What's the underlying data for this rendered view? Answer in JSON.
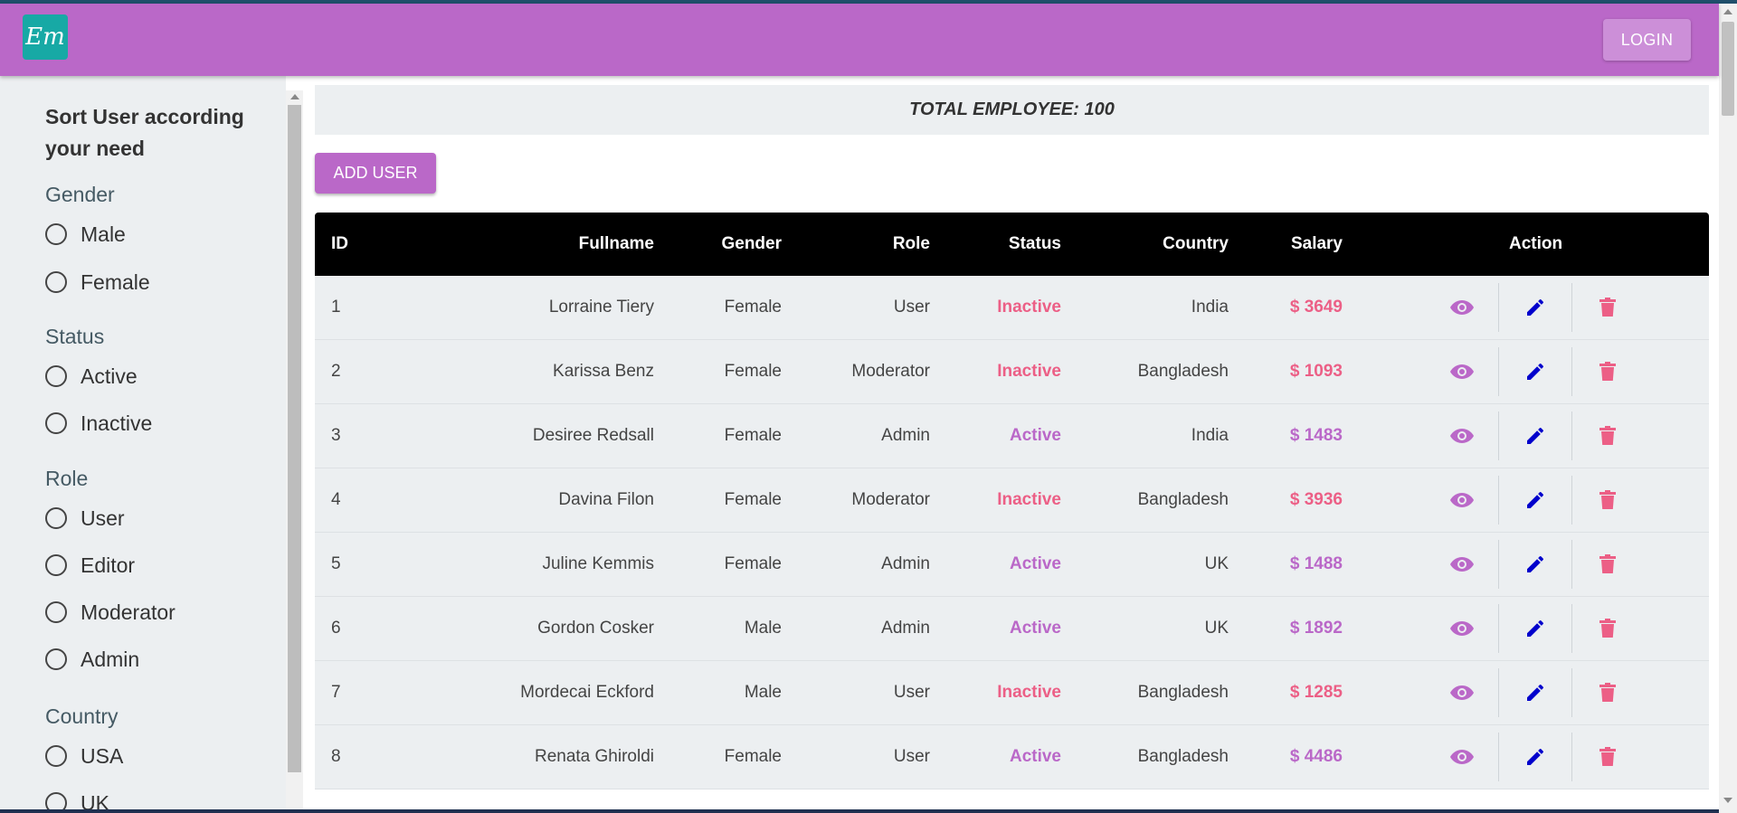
{
  "appbar": {
    "logo_text": "Em",
    "login_label": "LOGIN"
  },
  "sidebar": {
    "title": "Sort User according your need",
    "gender": {
      "heading": "Gender",
      "options": [
        "Male",
        "Female"
      ]
    },
    "status": {
      "heading": "Status",
      "options": [
        "Active",
        "Inactive"
      ]
    },
    "role": {
      "heading": "Role",
      "options": [
        "User",
        "Editor",
        "Moderator",
        "Admin"
      ]
    },
    "country": {
      "heading": "Country",
      "options": [
        "USA",
        "UK"
      ]
    }
  },
  "main": {
    "total_label": "TOTAL EMPLOYEE: 100",
    "add_user_label": "ADD USER"
  },
  "table": {
    "headers": {
      "id": "ID",
      "fullname": "Fullname",
      "gender": "Gender",
      "role": "Role",
      "status": "Status",
      "country": "Country",
      "salary": "Salary",
      "action": "Action"
    },
    "rows": [
      {
        "id": "1",
        "fullname": "Lorraine Tiery",
        "gender": "Female",
        "role": "User",
        "status": "Inactive",
        "country": "India",
        "salary": "$ 3649"
      },
      {
        "id": "2",
        "fullname": "Karissa Benz",
        "gender": "Female",
        "role": "Moderator",
        "status": "Inactive",
        "country": "Bangladesh",
        "salary": "$ 1093"
      },
      {
        "id": "3",
        "fullname": "Desiree Redsall",
        "gender": "Female",
        "role": "Admin",
        "status": "Active",
        "country": "India",
        "salary": "$ 1483"
      },
      {
        "id": "4",
        "fullname": "Davina Filon",
        "gender": "Female",
        "role": "Moderator",
        "status": "Inactive",
        "country": "Bangladesh",
        "salary": "$ 3936"
      },
      {
        "id": "5",
        "fullname": "Juline Kemmis",
        "gender": "Female",
        "role": "Admin",
        "status": "Active",
        "country": "UK",
        "salary": "$ 1488"
      },
      {
        "id": "6",
        "fullname": "Gordon Cosker",
        "gender": "Male",
        "role": "Admin",
        "status": "Active",
        "country": "UK",
        "salary": "$ 1892"
      },
      {
        "id": "7",
        "fullname": "Mordecai Eckford",
        "gender": "Male",
        "role": "User",
        "status": "Inactive",
        "country": "Bangladesh",
        "salary": "$ 1285"
      },
      {
        "id": "8",
        "fullname": "Renata Ghiroldi",
        "gender": "Female",
        "role": "User",
        "status": "Active",
        "country": "Bangladesh",
        "salary": "$ 4486"
      }
    ]
  },
  "icons": {
    "view": "eye-icon",
    "edit": "pencil-icon",
    "delete": "trash-icon"
  },
  "colors": {
    "primary": "#ba68c8",
    "logo_bg": "#17a9a5",
    "inactive": "#ec5f86",
    "edit": "#0000cc",
    "header": "#000000",
    "row_bg": "#eceff1"
  }
}
